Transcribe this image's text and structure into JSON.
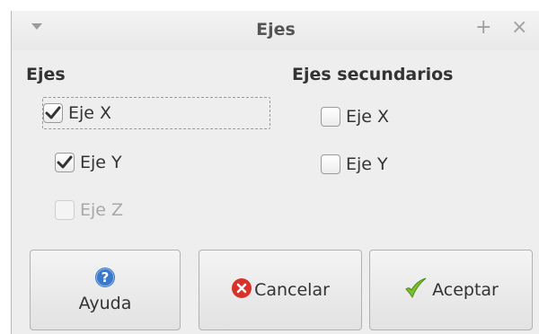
{
  "window": {
    "title": "Ejes",
    "icons": [
      "menu-arrow-icon",
      "pin-icon",
      "close-icon"
    ]
  },
  "axes": {
    "heading": "Ejes",
    "x": {
      "label": "Eje X",
      "checked": true
    },
    "y": {
      "label": "Eje Y",
      "checked": true
    },
    "z": {
      "label": "Eje Z",
      "checked": false,
      "enabled": false
    }
  },
  "secondary": {
    "heading": "Ejes secundarios",
    "x": {
      "label": "Eje X",
      "checked": false
    },
    "y": {
      "label": "Eje Y",
      "checked": false
    }
  },
  "buttons": {
    "help": {
      "label": "Ayuda",
      "icon": "help-icon"
    },
    "cancel": {
      "label": "Cancelar",
      "icon": "cancel-icon"
    },
    "ok": {
      "label": "Aceptar",
      "icon": "checkmark-icon"
    }
  },
  "colors": {
    "help": "#3a79c9",
    "cancel": "#d8322a",
    "ok": "#7cc02e"
  }
}
